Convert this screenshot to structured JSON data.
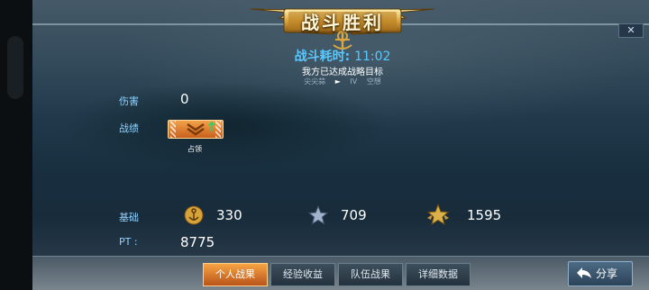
{
  "header": {
    "title": "战斗胜利",
    "duration_label": "战斗耗时:",
    "duration_value": "11:02",
    "result_text": "我方已达成战略目标",
    "progress": {
      "from": "尖尖蒜",
      "to_level": "IV",
      "to_name": "空想"
    }
  },
  "stats": {
    "damage_label": "伤害",
    "damage_value": "0",
    "record_label": "战绩",
    "achievement_label": "占领",
    "base_label": "基础",
    "base_rewards": [
      {
        "icon": "anchor-coin-icon",
        "value": "330"
      },
      {
        "icon": "silver-star-icon",
        "value": "709"
      },
      {
        "icon": "gold-star-icon",
        "value": "1595"
      }
    ],
    "pt_label": "PT :",
    "pt_value": "8775"
  },
  "tabs": [
    {
      "label": "个人战果",
      "active": true
    },
    {
      "label": "经验收益",
      "active": false
    },
    {
      "label": "队伍战果",
      "active": false
    },
    {
      "label": "详细数据",
      "active": false
    }
  ],
  "share_label": "分享",
  "close_label": "✕",
  "colors": {
    "accent_blue": "#58c8ff",
    "tab_active": "#f6a443",
    "label_blue": "#8fd2ff"
  }
}
